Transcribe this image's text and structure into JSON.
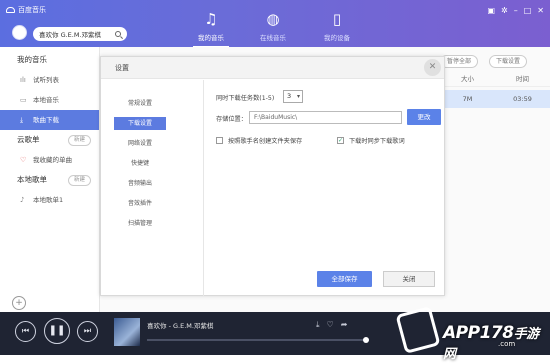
{
  "app": {
    "title": "百度音乐"
  },
  "search": {
    "value": "喜欢你 G.E.M.邓紫棋"
  },
  "nav_tabs": [
    {
      "label": "我的音乐",
      "icon": "music-note-icon"
    },
    {
      "label": "在线音乐",
      "icon": "globe-icon"
    },
    {
      "label": "我的设备",
      "icon": "phone-icon"
    }
  ],
  "window_controls": [
    "skin-icon",
    "settings-icon",
    "minimize-icon",
    "maximize-icon",
    "close-icon"
  ],
  "sidebar": {
    "my_music": "我的音乐",
    "items": [
      {
        "label": "试听列表",
        "icon": "waveform-icon"
      },
      {
        "label": "本地音乐",
        "icon": "monitor-icon"
      },
      {
        "label": "歌曲下载",
        "icon": "download-icon"
      }
    ],
    "cloud": "云歌单",
    "cloud_new": "新建",
    "cloud_items": [
      {
        "label": "我收藏的单曲",
        "icon": "heart-icon"
      }
    ],
    "local": "本地歌单",
    "local_new": "新建",
    "local_items": [
      {
        "label": "本地歌单1",
        "icon": "music-note-icon"
      }
    ]
  },
  "list_toolbar": {
    "pause_all": "暂停全部",
    "download_settings": "下载设置"
  },
  "table": {
    "headers": [
      "大小",
      "时间"
    ],
    "rows": [
      {
        "size": "7M",
        "time": "03:59"
      }
    ]
  },
  "dialog": {
    "title": "设置",
    "nav": [
      "常规设置",
      "下载设置",
      "网络设置",
      "快捷键",
      "音频输出",
      "音效插件",
      "扫描管理"
    ],
    "active_nav": "下载设置",
    "tasks_label": "同时下载任务数(1-5)",
    "tasks_value": "3",
    "path_label": "存储位置：",
    "path_value": "F:\\BaiduMusic\\",
    "change_button": "更改",
    "folder_by_singer": "按照歌手名创建文件夹保存",
    "lyrics_sync": "下载时同步下载歌词",
    "lyrics_checked": true,
    "save_all": "全部保存",
    "close": "关闭"
  },
  "player": {
    "title": "喜欢你 - G.E.M.邓紫棋",
    "progress": 0.97
  },
  "watermark": {
    "text": "APP178",
    "suffix": "手游网",
    "domain": ".com"
  }
}
